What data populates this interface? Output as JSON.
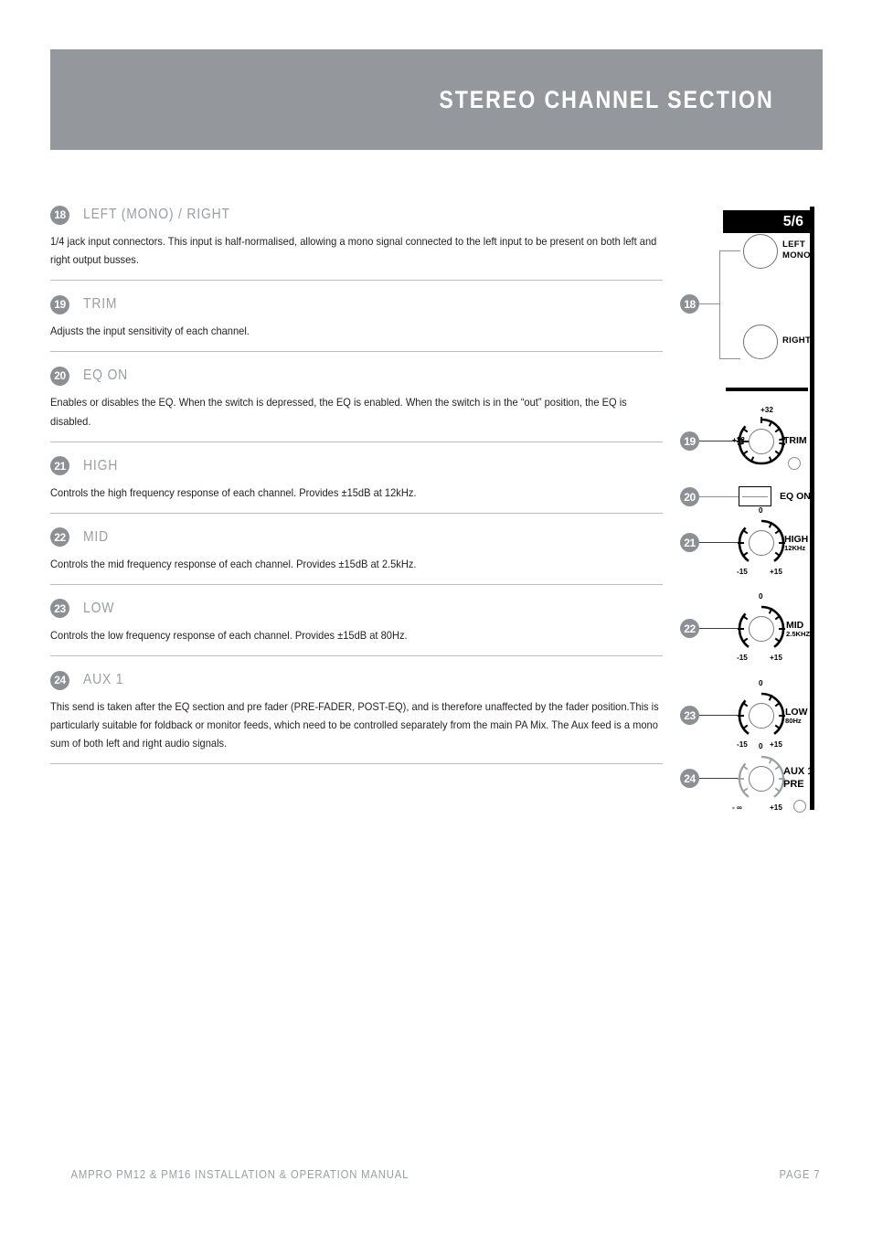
{
  "header": {
    "title": "STEREO CHANNEL SECTION"
  },
  "entries": [
    {
      "number": "18",
      "title": "LEFT (MONO) / RIGHT",
      "body": "1/4 jack input connectors. This input is half-normalised, allowing a mono signal connected to the left input to be present on both left and right output busses."
    },
    {
      "number": "19",
      "title": "TRIM",
      "body": "Adjusts the input sensitivity of each channel."
    },
    {
      "number": "20",
      "title": "EQ ON",
      "body": "Enables or disables the EQ. When the switch is depressed, the EQ is enabled. When the switch is in the “out” position, the EQ is disabled."
    },
    {
      "number": "21",
      "title": "HIGH",
      "body": "Controls the high frequency response of each channel. Provides ±15dB at 12kHz."
    },
    {
      "number": "22",
      "title": "MID",
      "body": "Controls the mid frequency response of each channel. Provides ±15dB at 2.5kHz."
    },
    {
      "number": "23",
      "title": "LOW",
      "body": "Controls the low frequency response of each channel.  Provides ±15dB at 80Hz."
    },
    {
      "number": "24",
      "title": "AUX 1",
      "body": "This send is taken after the EQ section and pre fader (PRE-FADER, POST-EQ), and is therefore unaffected by the fader position.This is particularly suitable for foldback or monitor feeds, which need to be controlled separately from the main PA Mix. The Aux feed is a mono sum of both left and right audio signals."
    }
  ],
  "diagram": {
    "channel_label": "5/6",
    "callouts": {
      "jacks": "18",
      "trim": "19",
      "eq_on": "20",
      "high": "21",
      "mid": "22",
      "low": "23",
      "aux1": "24"
    },
    "jacks": [
      {
        "label_line1": "LEFT",
        "label_line2": "MONO"
      },
      {
        "label_line1": "RIGHT",
        "label_line2": ""
      }
    ],
    "controls": [
      {
        "name": "TRIM",
        "sub": "",
        "min_label": "+22",
        "max_label": "+32"
      },
      {
        "name": "EQ ON",
        "sub": "",
        "min_label": "",
        "max_label": ""
      },
      {
        "name": "HIGH",
        "sub": "12KHz",
        "center_label": "0",
        "min_label": "-15",
        "max_label": "+15"
      },
      {
        "name": "MID",
        "sub": "2.5KHZ",
        "center_label": "0",
        "min_label": "-15",
        "max_label": "+15"
      },
      {
        "name": "LOW",
        "sub": "80Hz",
        "center_label": "0",
        "min_label": "-15",
        "max_label": "+15"
      },
      {
        "name": "AUX 1",
        "sub": "PRE",
        "center_label": "0",
        "min_label": "- ∞",
        "max_label": "+15"
      }
    ]
  },
  "footer": {
    "left": "AMPRO PM12 & PM16 INSTALLATION & OPERATION MANUAL",
    "right": "PAGE 7"
  },
  "colors": {
    "header_band": "#94979c",
    "badge": "#8c9095",
    "title_text": "#9a9ea3",
    "body_text": "#231f20"
  }
}
